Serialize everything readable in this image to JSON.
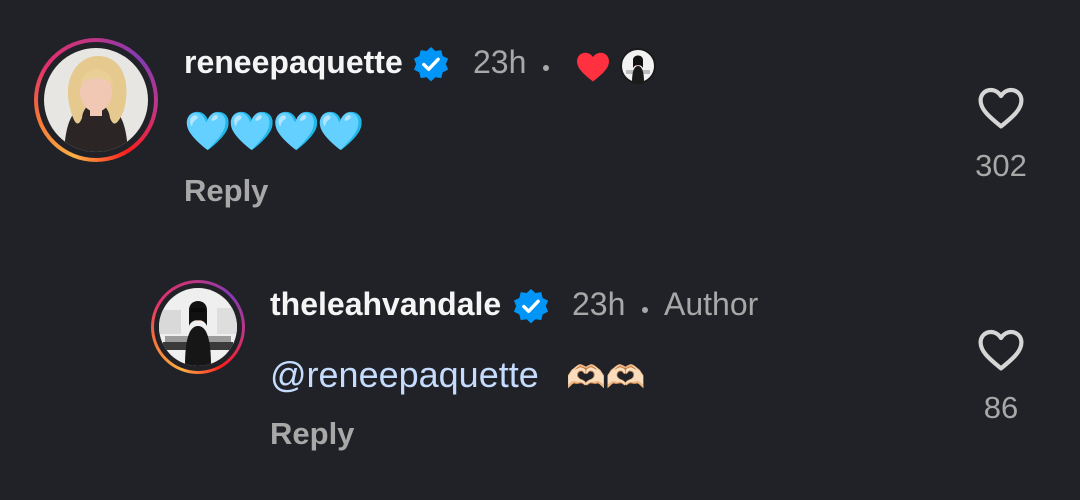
{
  "comments": [
    {
      "username": "reneepaquette",
      "verified": true,
      "time": "23h",
      "liked_by_author": true,
      "body_emoji": "🩵🩵🩵🩵",
      "reply_label": "Reply",
      "likes": "302"
    },
    {
      "username": "theleahvandale",
      "verified": true,
      "time": "23h",
      "author_tag": "Author",
      "mention": "@reneepaquette",
      "body_emoji": "🫶🏻🫶🏻",
      "reply_label": "Reply",
      "likes": "86"
    }
  ],
  "colors": {
    "background": "#212227",
    "verified_blue": "#0095f6",
    "mention_blue": "#c5dcff",
    "heart_red": "#ff3040",
    "muted_text": "#a8a8a8"
  },
  "icons": {
    "verified": "verified-badge-icon",
    "like": "heart-outline-icon",
    "creator_like": "heart-filled-icon"
  }
}
